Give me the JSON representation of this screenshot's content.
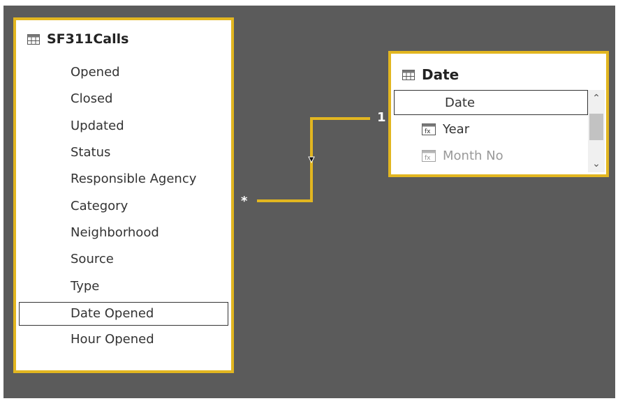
{
  "sf_table": {
    "title": "SF311Calls",
    "fields": [
      "Opened",
      "Closed",
      "Updated",
      "Status",
      "Responsible Agency",
      "Category",
      "Neighborhood",
      "Source",
      "Type",
      "Date Opened",
      "Hour Opened"
    ],
    "selected_field": "Date Opened"
  },
  "date_table": {
    "title": "Date",
    "fields": [
      "Date",
      "Year",
      "Month No"
    ],
    "selected_field": "Date"
  },
  "relationship": {
    "many_label": "*",
    "one_label": "1"
  },
  "colors": {
    "canvas": "#5b5b5b",
    "highlight": "#e2b620"
  },
  "icons": {
    "table": "table-icon",
    "calculated": "calculated-column-icon",
    "scroll_up": "chevron-up-icon",
    "scroll_down": "chevron-down-icon",
    "filter_arrow": "filter-direction-icon"
  }
}
